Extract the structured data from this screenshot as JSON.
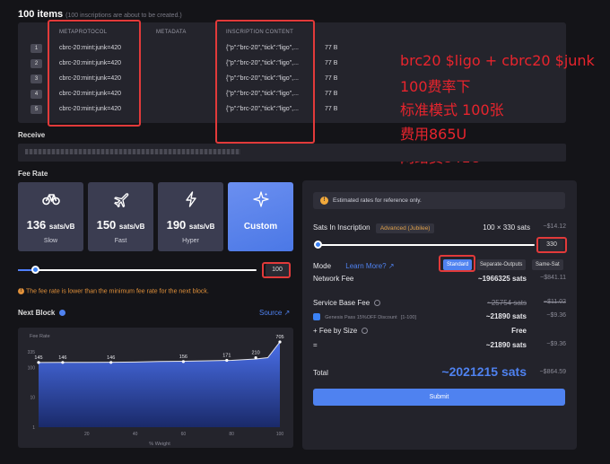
{
  "header": {
    "title": "100 items",
    "subtitle": "(100 inscriptions are about to be created.)"
  },
  "table": {
    "columns": [
      "METAPROTOCOL",
      "METADATA",
      "INSCRIPTION CONTENT"
    ],
    "rows": [
      {
        "num": "1",
        "metaprotocol": "cbrc-20:mint:junk=420",
        "content": "{\"p\":\"brc-20\",\"tick\":\"ligo\",...",
        "size": "77 B"
      },
      {
        "num": "2",
        "metaprotocol": "cbrc-20:mint:junk=420",
        "content": "{\"p\":\"brc-20\",\"tick\":\"ligo\",...",
        "size": "77 B"
      },
      {
        "num": "3",
        "metaprotocol": "cbrc-20:mint:junk=420",
        "content": "{\"p\":\"brc-20\",\"tick\":\"ligo\",...",
        "size": "77 B"
      },
      {
        "num": "4",
        "metaprotocol": "cbrc-20:mint:junk=420",
        "content": "{\"p\":\"brc-20\",\"tick\":\"ligo\",...",
        "size": "77 B"
      },
      {
        "num": "5",
        "metaprotocol": "cbrc-20:mint:junk=420",
        "content": "{\"p\":\"brc-20\",\"tick\":\"ligo\",...",
        "size": "77 B"
      }
    ]
  },
  "annotation": {
    "lines": [
      "brc20 $ligo + cbrc20 $junk",
      "100费率下",
      "标准模式 100张",
      "费用865U",
      "网络费841U"
    ],
    "color": "#e8242d"
  },
  "receive": {
    "label": "Receive"
  },
  "fee_rate": {
    "label": "Fee Rate",
    "cards": [
      {
        "icon": "bicycle-icon",
        "value": "136",
        "unit": "sats/vB",
        "label": "Slow"
      },
      {
        "icon": "jet-icon",
        "value": "150",
        "unit": "sats/vB",
        "label": "Fast"
      },
      {
        "icon": "lightning-icon",
        "value": "190",
        "unit": "sats/vB",
        "label": "Hyper"
      },
      {
        "icon": "sparkle-icon",
        "label": "Custom"
      }
    ],
    "custom_value": "100",
    "slider_fraction": 0.07,
    "warning": "The fee rate is lower than the minimum fee rate for the next block."
  },
  "next_block": {
    "label": "Next Block",
    "source": "Source ↗"
  },
  "chart_data": {
    "type": "area",
    "title": "Fee Rate",
    "ylabel": "",
    "xlabel": "% Weight",
    "x": [
      0,
      10,
      20,
      30,
      40,
      50,
      60,
      70,
      80,
      90,
      95,
      100
    ],
    "y": [
      145,
      146,
      146,
      148,
      150,
      156,
      160,
      165,
      171,
      190,
      210,
      705
    ],
    "point_labels": [
      {
        "x": 0,
        "y": 145,
        "label": "145"
      },
      {
        "x": 10,
        "y": 146,
        "label": "146"
      },
      {
        "x": 30,
        "y": 146,
        "label": "146"
      },
      {
        "x": 60,
        "y": 156,
        "label": "156"
      },
      {
        "x": 78,
        "y": 171,
        "label": "171"
      },
      {
        "x": 90,
        "y": 210,
        "label": "210"
      },
      {
        "x": 100,
        "y": 705,
        "label": "705"
      }
    ],
    "y_scale": "log",
    "ylim": [
      1,
      705
    ],
    "y_ticks": [
      "335",
      "100",
      "10",
      "1"
    ],
    "x_ticks": [
      "20",
      "40",
      "60",
      "80",
      "100"
    ],
    "colors": {
      "top": "#4a6fe8",
      "bottom": "#1a2a6a"
    }
  },
  "panel": {
    "notice": "Estimated rates for reference only.",
    "sats_in_inscription": {
      "label": "Sats In Inscription",
      "mode": "Advanced (Jubilee)",
      "value": "100 × 330 sats",
      "usd": "~$14.12"
    },
    "sats_slider_value": "330",
    "sats_slider_fraction": 0.0,
    "mode": {
      "label": "Mode",
      "learn_more": "Learn More? ↗",
      "options": [
        "Standard",
        "Separate-Outputs",
        "Same-Sat"
      ],
      "selected": "Standard"
    },
    "network_fee": {
      "label": "Network Fee",
      "value": "~1966325 sats",
      "usd": "~$841.11"
    },
    "service_base_fee": {
      "label": "Service Base Fee",
      "value": "~25754 sats",
      "usd": "~$11.02"
    },
    "discount": {
      "label": "Genesis Pass 15%OFF Discount",
      "range": "[1-100]",
      "value": "~21890 sats",
      "usd": "~$9.36"
    },
    "fee_by_size": {
      "label": "+ Fee by Size",
      "value": "Free"
    },
    "equals": {
      "label": "=",
      "value": "~21890 sats",
      "usd": "~$9.36"
    },
    "total": {
      "label": "Total",
      "value": "~2021215 sats",
      "usd": "~$864.59"
    },
    "submit": "Submit"
  }
}
